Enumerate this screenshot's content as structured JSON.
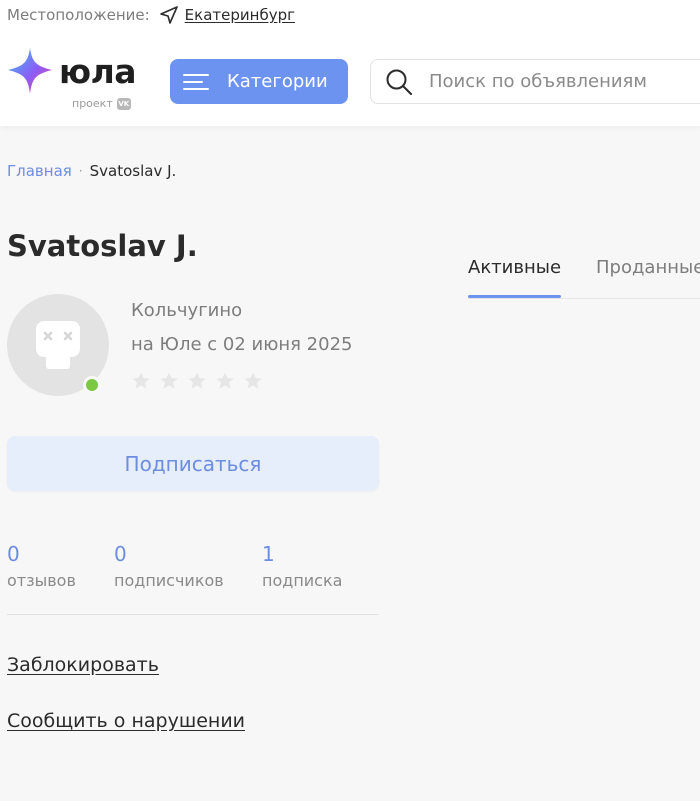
{
  "location": {
    "label": "Местоположение:",
    "city": "Екатеринбург",
    "icon": "navigation-arrow-icon"
  },
  "logo": {
    "text": "юла",
    "subtitle": "проект",
    "badge": "VK"
  },
  "header": {
    "categories_label": "Категории",
    "search_placeholder": "Поиск по объявлениям"
  },
  "breadcrumb": {
    "home": "Главная",
    "separator": "·",
    "current": "Svatoslav J."
  },
  "profile": {
    "name": "Svatoslav J.",
    "city": "Кольчугино",
    "member_since": "на Юле с 02 июня 2025",
    "rating": 0,
    "rating_max": 5,
    "online": true,
    "subscribe_label": "Подписаться",
    "stats": [
      {
        "value": "0",
        "label": "отзывов"
      },
      {
        "value": "0",
        "label": "подписчиков"
      },
      {
        "value": "1",
        "label": "подписка"
      }
    ],
    "block_label": "Заблокировать",
    "report_label": "Сообщить о нарушении"
  },
  "tabs": [
    {
      "label": "Активные",
      "active": true
    },
    {
      "label": "Проданные",
      "active": false
    }
  ],
  "colors": {
    "accent": "#6c93f0",
    "link": "#6c8de0",
    "online": "#7cc842",
    "background": "#f7f7f7"
  }
}
